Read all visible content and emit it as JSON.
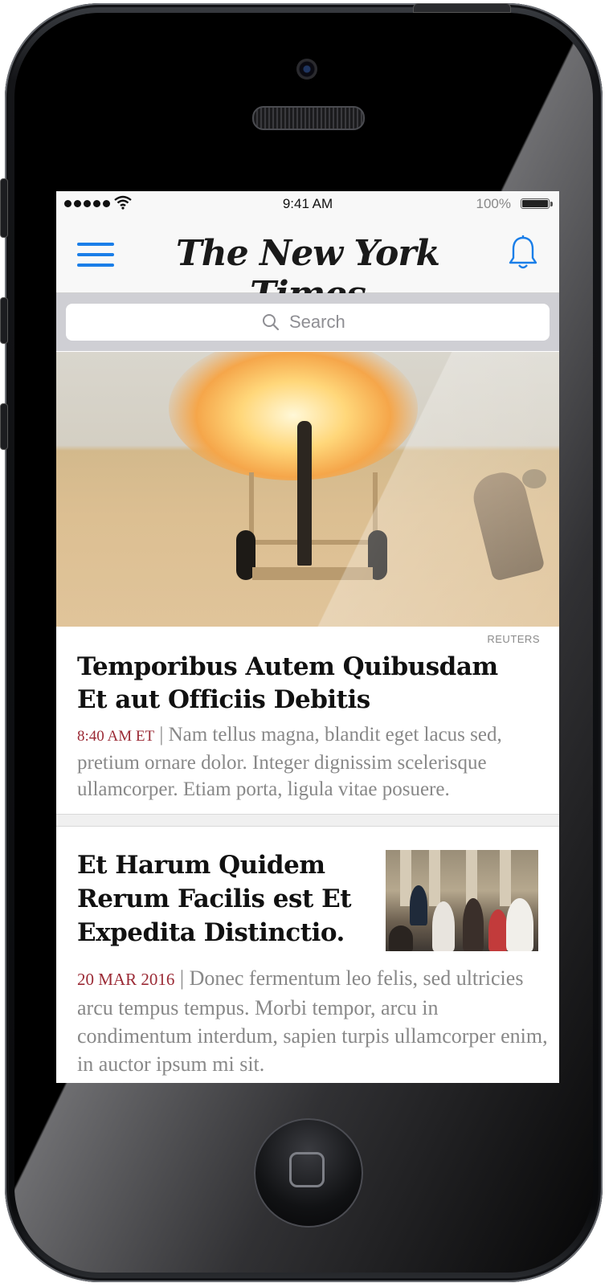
{
  "status_bar": {
    "time": "9:41 AM",
    "battery": "100%"
  },
  "nav": {
    "logo": "The New York Times",
    "menu_icon": "hamburger-menu-icon",
    "notifications_icon": "bell-icon"
  },
  "search": {
    "placeholder": "Search",
    "icon": "search-icon"
  },
  "articles": [
    {
      "photo_credit": "REUTERS",
      "headline": "Temporibus Autem Quibusdam Et aut Officiis Debitis",
      "timestamp": "8:40 AM ET",
      "separator": " | ",
      "summary": "Nam tellus magna, blandit eget lacus sed, pretium ornare dolor. Integer dignissim scelerisque ullamcorper. Etiam porta, ligula vitae posuere."
    },
    {
      "headline": "Et Harum Quidem Rerum Facilis est Et Expedita Distinctio.",
      "timestamp": "20 MAR 2016",
      "separator": " | ",
      "summary": "Donec fermentum leo felis, sed ultricies arcu tempus tempus. Morbi tempor, arcu in condimentum interdum, sapien turpis ullamcorper enim, in auctor ipsum mi sit."
    }
  ],
  "colors": {
    "accent_blue": "#1a7ee8",
    "timestamp_red": "#9b2a35",
    "summary_gray": "#888888"
  }
}
